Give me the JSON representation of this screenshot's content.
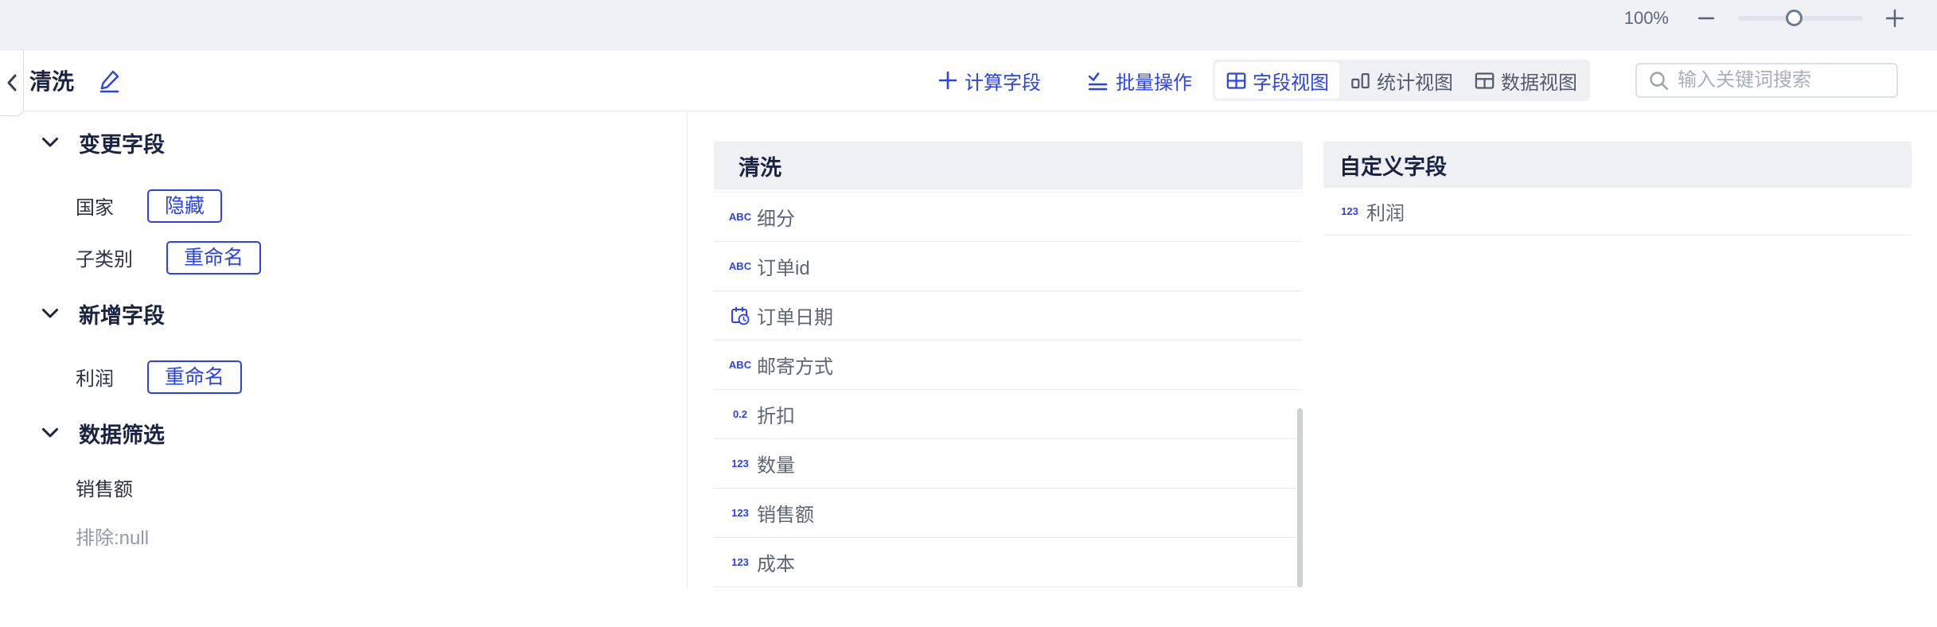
{
  "zoom_bar": {
    "level": "100%"
  },
  "header": {
    "title": "清洗",
    "calc_field_label": "计算字段",
    "batch_ops_label": "批量操作",
    "view_switcher": [
      {
        "label": "字段视图",
        "selected": true
      },
      {
        "label": "统计视图",
        "selected": false
      },
      {
        "label": "数据视图",
        "selected": false
      }
    ],
    "search_placeholder": "输入关键词搜索"
  },
  "left_panel": {
    "sections": [
      {
        "title": "变更字段",
        "items": [
          {
            "label": "国家",
            "action": "隐藏"
          },
          {
            "label": "子类别",
            "action": "重命名"
          }
        ]
      },
      {
        "title": "新增字段",
        "items": [
          {
            "label": "利润",
            "action": "重命名"
          }
        ]
      },
      {
        "title": "数据筛选",
        "items": [
          {
            "label": "销售额"
          },
          {
            "label": "排除:null",
            "muted": true
          }
        ]
      }
    ]
  },
  "field_panel": {
    "title": "清洗",
    "fields": [
      {
        "icon": "abc-icon",
        "glyph": "ABC",
        "name": "细分"
      },
      {
        "icon": "abc-icon",
        "glyph": "ABC",
        "name": "订单id"
      },
      {
        "icon": "calendar-clock-icon",
        "glyph": "",
        "name": "订单日期"
      },
      {
        "icon": "abc-icon",
        "glyph": "ABC",
        "name": "邮寄方式"
      },
      {
        "icon": "decimal-icon",
        "glyph": "0.2",
        "name": "折扣"
      },
      {
        "icon": "number-icon",
        "glyph": "123",
        "name": "数量"
      },
      {
        "icon": "number-icon",
        "glyph": "123",
        "name": "销售额"
      },
      {
        "icon": "number-icon",
        "glyph": "123",
        "name": "成本"
      }
    ]
  },
  "custom_panel": {
    "title": "自定义字段",
    "fields": [
      {
        "icon": "number-icon",
        "glyph": "123",
        "name": "利润"
      }
    ]
  },
  "colors": {
    "accent": "#2a43ee",
    "navy": "#1a2442",
    "field_text": "#5e6574",
    "muted_text": "#9199ad",
    "panel_header_bg": "#eef0f3",
    "topstrip_bg": "#eff1f4"
  }
}
